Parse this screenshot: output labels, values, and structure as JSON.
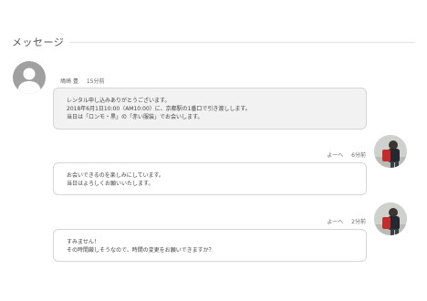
{
  "section": {
    "title": "メッセージ"
  },
  "messages": [
    {
      "sender": "鳩崎 豊",
      "time": "15分前",
      "avatar": "default-user-icon",
      "lines": [
        "レンタル申し込みありがとうございます。",
        "2018年6月1日10:00（AM10:00）に、京都駅の1番口で引き渡しします。",
        "当日は「ロンモ・黒」の「赤い服装」でお会いします。"
      ]
    },
    {
      "sender": "よーへ",
      "time": "6分前",
      "avatar": "user-photo-red-backpack",
      "lines": [
        "お会いできるのを楽しみにしています。",
        "当日はよろしくお願いいたします。"
      ]
    },
    {
      "sender": "よーへ",
      "time": "2分前",
      "avatar": "user-photo-red-backpack",
      "lines": [
        "すみません！",
        "その時間厳しそうなので、時間の変更をお願いできますか？"
      ]
    }
  ],
  "colors": {
    "bubble_incoming_bg": "#f2f2f2",
    "bubble_outgoing_bg": "#ffffff",
    "bubble_border": "#d6d6d6",
    "avatar_placeholder": "#a0a0a0"
  }
}
